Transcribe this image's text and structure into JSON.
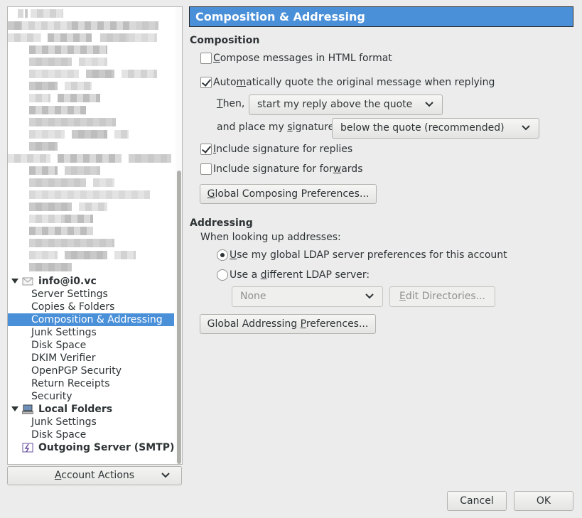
{
  "tree": {
    "account": {
      "label": "info@i0.vc",
      "items": [
        "Server Settings",
        "Copies & Folders",
        "Composition & Addressing",
        "Junk Settings",
        "Disk Space",
        "DKIM Verifier",
        "OpenPGP Security",
        "Return Receipts",
        "Security"
      ],
      "selected_index": 2
    },
    "local_folders": {
      "label": "Local Folders",
      "items": [
        "Junk Settings",
        "Disk Space"
      ]
    },
    "outgoing": {
      "label": "Outgoing Server (SMTP)"
    },
    "account_actions": {
      "before": "",
      "key": "A",
      "after": "ccount Actions"
    }
  },
  "header": {
    "title": "Composition & Addressing"
  },
  "composition": {
    "heading": "Composition",
    "html_format": {
      "before": "",
      "key": "C",
      "after": "ompose messages in HTML format",
      "checked": false
    },
    "auto_quote": {
      "before": "Auto",
      "key": "m",
      "after": "atically quote the original message when replying",
      "checked": true
    },
    "then": {
      "before": "",
      "key": "T",
      "after": "hen,",
      "value": "start my reply above the quote"
    },
    "signature": {
      "before": "and place my ",
      "key": "s",
      "after": "ignature",
      "value": "below the quote (recommended)"
    },
    "sig_replies": {
      "before": "",
      "key": "I",
      "after": "nclude signature for replies",
      "checked": true
    },
    "sig_forwards": {
      "before": "Include signature for for",
      "key": "w",
      "after": "ards",
      "checked": false
    },
    "global_btn": {
      "before": "",
      "key": "G",
      "after": "lobal Composing Preferences..."
    }
  },
  "addressing": {
    "heading": "Addressing",
    "lookup_label": "When looking up addresses:",
    "use_global": {
      "before": "",
      "key": "U",
      "after": "se my global LDAP server preferences for this account",
      "selected": true
    },
    "use_different": {
      "before": "Use a ",
      "key": "d",
      "after": "ifferent LDAP server:",
      "selected": false
    },
    "ldap_select": {
      "value": "None"
    },
    "edit_dirs": {
      "before": "",
      "key": "E",
      "after": "dit Directories..."
    },
    "global_btn": {
      "before": "Global Addressing ",
      "key": "P",
      "after": "references..."
    }
  },
  "dialog": {
    "cancel": "Cancel",
    "ok": "OK"
  },
  "colors": {
    "accent": "#4a90d9",
    "background": "#ececec"
  }
}
